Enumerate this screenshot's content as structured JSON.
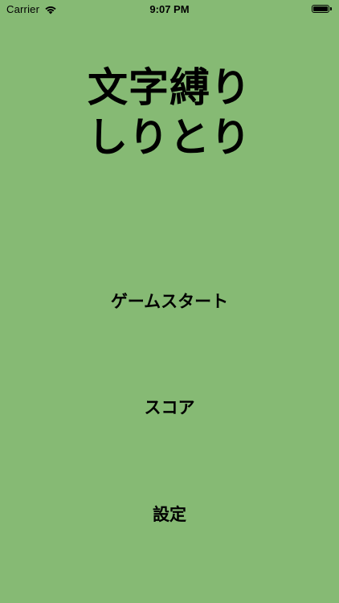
{
  "status_bar": {
    "carrier": "Carrier",
    "time": "9:07 PM",
    "wifi_icon": "wifi-icon",
    "battery_icon": "battery-icon",
    "battery_level_fraction": 1.0
  },
  "title": {
    "line1": "文字縛り",
    "line2": "しりとり"
  },
  "menu": {
    "start_label": "ゲームスタート",
    "score_label": "スコア",
    "settings_label": "設定"
  },
  "colors": {
    "background": "#86ba74",
    "text": "#000000"
  }
}
